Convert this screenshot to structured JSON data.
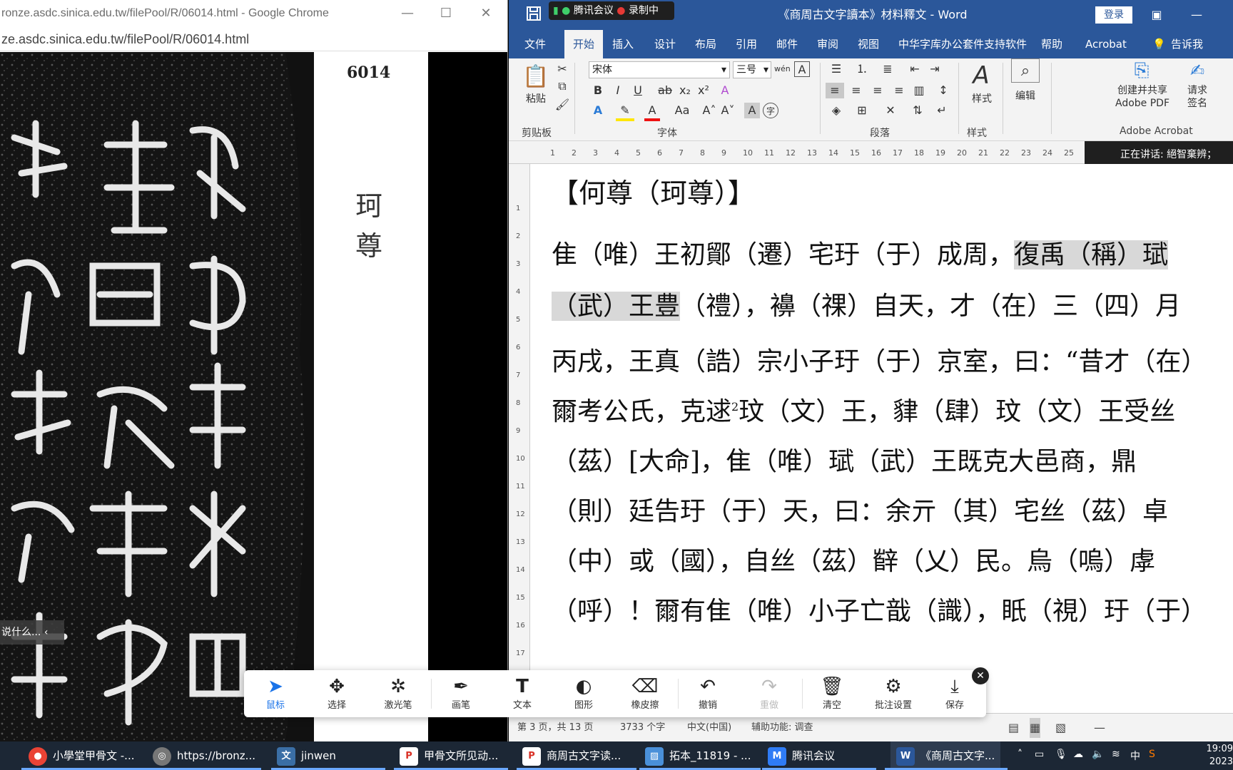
{
  "chrome": {
    "title": "ronze.asdc.sinica.edu.tw/filePool/R/06014.html - Google Chrome",
    "url": "ze.asdc.sinica.edu.tw/filePool/R/06014.html",
    "plate_number": "6014",
    "vertical_title": "珂尊",
    "tip": "说什么..."
  },
  "word": {
    "meeting_app": "腾讯会议",
    "recording": "录制中",
    "doc_title": "《商周古文字讀本》材料釋文 - Word",
    "login": "登录",
    "menu": [
      "文件",
      "开始",
      "插入",
      "设计",
      "布局",
      "引用",
      "邮件",
      "审阅",
      "视图",
      "中华字库办公套件支持软件",
      "帮助",
      "Acrobat",
      "告诉我"
    ],
    "ribbon": {
      "paste": "粘贴",
      "clipboard": "剪贴板",
      "font_name": "宋体",
      "font_size": "三号",
      "font_group": "字体",
      "paragraph_group": "段落",
      "styles_btn": "样式",
      "styles_group": "样式",
      "edit_btn": "编辑",
      "create_share": "创建并共享",
      "adobe_pdf": "Adobe PDF",
      "request": "请求",
      "sign": "签名",
      "acrobat_group": "Adobe Acrobat"
    },
    "speaking": "正在讲话: 絕智棄辨；",
    "heading": "【何尊（珂尊）】",
    "lines": [
      {
        "pre": "隹（唯）王初鄮（遷）宅玗（于）成周，",
        "hl": "復禹（稱）珷",
        "post": ""
      },
      {
        "pre": "",
        "hl": "（武）王豊",
        "post": "（禮），襣（祼）自天，才（在）三（四）月"
      },
      {
        "pre": "丙戌，王真（誥）宗小子玗（于）京室，曰：“昔才（在）",
        "hl": "",
        "post": ""
      },
      {
        "pre": "爾考公氏，克逑",
        "sup": "2",
        "post2": "玟（文）王，貄（肆）玟（文）王受丝"
      },
      {
        "pre": "（茲）[大命]，隹（唯）珷（武）王既克大邑商，鼎",
        "hl": "",
        "post": ""
      },
      {
        "pre": "（則）廷告玗（于）天，曰：余亓（其）宅丝（茲）卓",
        "hl": "",
        "post": ""
      },
      {
        "pre": "（中）或（國），自丝（茲）辥（乂）民。烏（嗚）虖",
        "hl": "",
        "post": ""
      },
      {
        "pre": "（呼）！爾有隹（唯）小子亡戠（識），眂（視）玗（于）",
        "hl": "",
        "post": ""
      }
    ],
    "status": {
      "page": "第 3 页，共 13 页",
      "words": "3733 个字",
      "lang": "中文(中国)",
      "accessibility": "辅助功能: 调查"
    }
  },
  "annotation_toolbar": [
    {
      "label": "鼠标",
      "icon": "cursor-icon"
    },
    {
      "label": "选择",
      "icon": "move-icon"
    },
    {
      "label": "激光笔",
      "icon": "laser-icon"
    },
    {
      "label": "画笔",
      "icon": "pen-icon"
    },
    {
      "label": "文本",
      "icon": "text-icon"
    },
    {
      "label": "图形",
      "icon": "shape-icon"
    },
    {
      "label": "橡皮擦",
      "icon": "eraser-icon"
    },
    {
      "label": "撤销",
      "icon": "undo-icon"
    },
    {
      "label": "重做",
      "icon": "redo-icon"
    },
    {
      "label": "清空",
      "icon": "trash-icon"
    },
    {
      "label": "批注设置",
      "icon": "settings-icon"
    },
    {
      "label": "保存",
      "icon": "download-icon"
    }
  ],
  "taskbar": [
    {
      "label": "小學堂甲骨文 -...",
      "icon": "chrome-icon",
      "color": "#ea4335"
    },
    {
      "label": "https://bronz...",
      "icon": "browser-icon",
      "color": "#777777"
    },
    {
      "label": "jinwen",
      "icon": "app-icon",
      "color": "#3a6ea5"
    },
    {
      "label": "甲骨文所见动...",
      "icon": "pdf-icon",
      "color": "#d93025"
    },
    {
      "label": "商周古文字读...",
      "icon": "pdf-icon",
      "color": "#d93025"
    },
    {
      "label": "拓本_11819 - ...",
      "icon": "image-icon",
      "color": "#4a90d9"
    },
    {
      "label": "腾讯会议",
      "icon": "meeting-icon",
      "color": "#2f7cf6"
    },
    {
      "label": "《商周古文字...",
      "icon": "word-icon",
      "color": "#2b579a"
    }
  ],
  "tray": {
    "ime": "中",
    "time": "19:09",
    "date": "2023"
  }
}
